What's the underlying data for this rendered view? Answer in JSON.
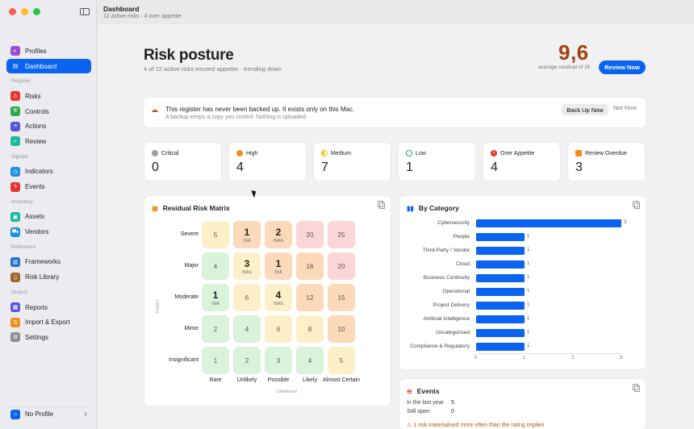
{
  "window": {
    "title": "Dashboard",
    "subtitle": "12 active risks · 4 over appetite"
  },
  "sidebar": {
    "groups": [
      {
        "label": "",
        "items": [
          {
            "label": "Profiles",
            "icon": "profiles-icon",
            "color": "#9b4fd0"
          },
          {
            "label": "Dashboard",
            "icon": "dashboard-icon",
            "color": "#0a64f0",
            "active": true
          }
        ]
      },
      {
        "label": "Register",
        "items": [
          {
            "label": "Risks",
            "icon": "warning-icon",
            "color": "#e3342f"
          },
          {
            "label": "Controls",
            "icon": "shield-icon",
            "color": "#2ba84a"
          },
          {
            "label": "Actions",
            "icon": "list-icon",
            "color": "#5856d6"
          },
          {
            "label": "Review",
            "icon": "check-icon",
            "color": "#19b8a0"
          }
        ]
      },
      {
        "label": "Signals",
        "items": [
          {
            "label": "Indicators",
            "icon": "gauge-icon",
            "color": "#1d8fe0"
          },
          {
            "label": "Events",
            "icon": "bolt-icon",
            "color": "#e3342f"
          }
        ]
      },
      {
        "label": "Inventory",
        "items": [
          {
            "label": "Assets",
            "icon": "box-icon",
            "color": "#19b8a0"
          },
          {
            "label": "Vendors",
            "icon": "truck-icon",
            "color": "#1d8fe0"
          }
        ]
      },
      {
        "label": "Reference",
        "items": [
          {
            "label": "Frameworks",
            "icon": "framework-icon",
            "color": "#1d6fd0"
          },
          {
            "label": "Risk Library",
            "icon": "book-icon",
            "color": "#a0662b"
          }
        ]
      },
      {
        "label": "Output",
        "items": [
          {
            "label": "Reports",
            "icon": "report-icon",
            "color": "#5856d6"
          },
          {
            "label": "Import & Export",
            "icon": "import-export-icon",
            "color": "#f08c1a"
          },
          {
            "label": "Settings",
            "icon": "gear-icon",
            "color": "#8e8e93"
          }
        ]
      }
    ],
    "profile_label": "No Profile"
  },
  "header": {
    "title": "Risk posture",
    "subtitle": "4 of 12 active risks exceed appetite · trending down",
    "avg_value": "9,6",
    "avg_caption": "average residual of 25",
    "review_button": "Review Now"
  },
  "banner": {
    "title": "This register has never been backed up. It exists only on this Mac.",
    "subtitle": "A backup keeps a copy you control. Nothing is uploaded.",
    "backup_button": "Back Up Now",
    "not_now_button": "Not Now"
  },
  "stats": [
    {
      "label": "Critical",
      "value": "0",
      "color": "#9e9ea3",
      "shape": "dot"
    },
    {
      "label": "High",
      "value": "4",
      "color": "#f08c1a",
      "shape": "dot"
    },
    {
      "label": "Medium",
      "value": "7",
      "color": "#f5c518",
      "shape": "half"
    },
    {
      "label": "Low",
      "value": "1",
      "color": "#2ba84a",
      "shape": "ring"
    },
    {
      "label": "Over Appetite",
      "value": "4",
      "color": "#e3342f",
      "shape": "x"
    },
    {
      "label": "Review Overdue",
      "value": "3",
      "color": "#f08c1a",
      "shape": "calendar"
    }
  ],
  "matrix": {
    "title": "Residual Risk Matrix",
    "rows": [
      "Severe",
      "Major",
      "Moderate",
      "Minor",
      "Insignificant"
    ],
    "cols": [
      "Rare",
      "Unlikely",
      "Possible",
      "Likely",
      "Almost Certain"
    ],
    "y_axis": "Impact",
    "x_axis": "Likelihood",
    "cells": [
      [
        {
          "v": "5",
          "c": "#fdf0c8"
        },
        {
          "v": "1",
          "s": "risk",
          "c": "#fbd9b9"
        },
        {
          "v": "2",
          "s": "risks",
          "c": "#fbd9b9"
        },
        {
          "v": "20",
          "c": "#fbd6d6"
        },
        {
          "v": "25",
          "c": "#fbd6d6"
        }
      ],
      [
        {
          "v": "4",
          "c": "#d8f3da"
        },
        {
          "v": "3",
          "s": "risks",
          "c": "#fdf0c8"
        },
        {
          "v": "1",
          "s": "risk",
          "c": "#fbd9b9"
        },
        {
          "v": "16",
          "c": "#fbd9b9"
        },
        {
          "v": "20",
          "c": "#fbd6d6"
        }
      ],
      [
        {
          "v": "1",
          "s": "risk",
          "c": "#d8f3da"
        },
        {
          "v": "6",
          "c": "#fdf0c8"
        },
        {
          "v": "4",
          "s": "risks",
          "c": "#fdf0c8"
        },
        {
          "v": "12",
          "c": "#fbd9b9"
        },
        {
          "v": "15",
          "c": "#fbd9b9"
        }
      ],
      [
        {
          "v": "2",
          "c": "#d8f3da"
        },
        {
          "v": "4",
          "c": "#d8f3da"
        },
        {
          "v": "6",
          "c": "#fdf0c8"
        },
        {
          "v": "8",
          "c": "#fdf0c8"
        },
        {
          "v": "10",
          "c": "#fbd9b9"
        }
      ],
      [
        {
          "v": "1",
          "c": "#d8f3da"
        },
        {
          "v": "2",
          "c": "#d8f3da"
        },
        {
          "v": "3",
          "c": "#d8f3da"
        },
        {
          "v": "4",
          "c": "#d8f3da"
        },
        {
          "v": "5",
          "c": "#fdf0c8"
        }
      ]
    ]
  },
  "category": {
    "title": "By Category",
    "items": [
      {
        "label": "Cybersecurity",
        "value": 3
      },
      {
        "label": "People",
        "value": 1
      },
      {
        "label": "Third-Party / Vendor",
        "value": 1
      },
      {
        "label": "Cloud",
        "value": 1
      },
      {
        "label": "Business Continuity",
        "value": 1
      },
      {
        "label": "Operational",
        "value": 1
      },
      {
        "label": "Project Delivery",
        "value": 1
      },
      {
        "label": "Artificial Intelligence",
        "value": 1
      },
      {
        "label": "Uncategorised",
        "value": 1
      },
      {
        "label": "Compliance & Regulatory",
        "value": 1
      }
    ],
    "x_ticks": [
      "0",
      "1",
      "2",
      "3"
    ],
    "x_max": 3,
    "bar_color": "#0a64f0"
  },
  "events": {
    "title": "Events",
    "rows": [
      {
        "label": "In the last year",
        "value": "5"
      },
      {
        "label": "Still open",
        "value": "0"
      }
    ],
    "warning": "1 risk materialised more often than the rating implies"
  }
}
